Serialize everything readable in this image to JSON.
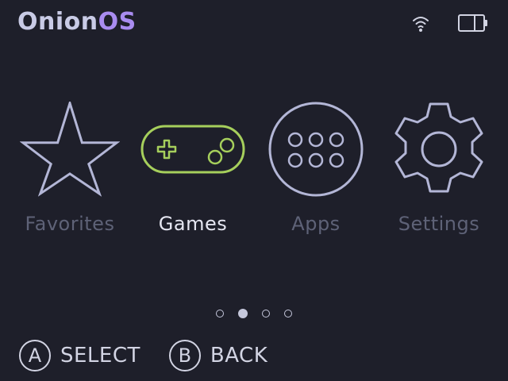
{
  "header": {
    "brand_part1": "Onion",
    "brand_part2": "OS",
    "status_icons": [
      "wifi-icon",
      "battery-icon"
    ]
  },
  "menu": {
    "items": [
      {
        "label": "Favorites",
        "icon": "star-icon",
        "selected": false
      },
      {
        "label": "Games",
        "icon": "gamepad-icon",
        "selected": true
      },
      {
        "label": "Apps",
        "icon": "apps-grid-icon",
        "selected": false
      },
      {
        "label": "Settings",
        "icon": "gear-icon",
        "selected": false
      }
    ]
  },
  "pagination": {
    "count": 4,
    "active_index": 1
  },
  "footer": {
    "hints": [
      {
        "button": "A",
        "label": "SELECT"
      },
      {
        "button": "B",
        "label": "BACK"
      }
    ]
  },
  "colors": {
    "background": "#1e1f2a",
    "brand_accent": "#a98cf0",
    "selected_icon": "#a6cf5c",
    "icon_inactive": "#b3b6d6",
    "label_inactive": "#5e6277"
  }
}
